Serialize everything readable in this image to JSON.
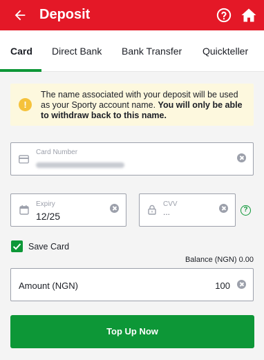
{
  "header": {
    "title": "Deposit",
    "background": "#e41827",
    "icons": [
      "back-arrow-icon",
      "help-icon",
      "home-icon"
    ]
  },
  "tabs": [
    {
      "label": "Card",
      "active": true
    },
    {
      "label": "Direct Bank",
      "active": false
    },
    {
      "label": "Bank Transfer",
      "active": false
    },
    {
      "label": "Quickteller",
      "active": false
    }
  ],
  "notice": {
    "text": "The name associated with your deposit will be used as your Sporty account name. ",
    "bold_text": "You will only be able to withdraw back to this name."
  },
  "card_number": {
    "label": "Card Number",
    "masked_value": "blurred"
  },
  "expiry": {
    "label": "Expiry",
    "value": "12/25"
  },
  "cvv": {
    "label": "CVV",
    "value": "..."
  },
  "save_card": {
    "label": "Save Card",
    "checked": true
  },
  "balance": {
    "text": "Balance (NGN) 0.00"
  },
  "amount": {
    "label": "Amount (NGN)",
    "value": "100"
  },
  "topup_button": {
    "label": "Top Up Now"
  },
  "colors": {
    "brand_red": "#e41827",
    "accent_green": "#0d9737",
    "notice_bg": "#fdf8de",
    "warn_yellow": "#f5c23b"
  }
}
